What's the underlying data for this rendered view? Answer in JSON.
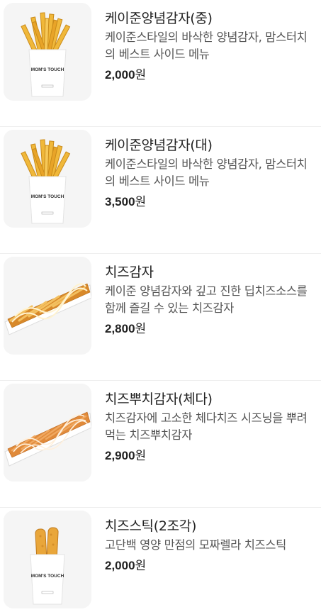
{
  "menu": {
    "items": [
      {
        "name": "케이준양념감자(중)",
        "desc": "케이준스타일의 바삭한 양념감자, 맘스터치의 베스트 사이드 메뉴",
        "price": "2,000",
        "unit": "원",
        "image": "fries-bag-medium",
        "bag_text": "MOM'S TOUCH"
      },
      {
        "name": "케이준양념감자(대)",
        "desc": "케이준스타일의 바삭한 양념감자, 맘스터치의 베스트 사이드 메뉴",
        "price": "3,500",
        "unit": "원",
        "image": "fries-bag-large",
        "bag_text": "MOM'S TOUCH"
      },
      {
        "name": "치즈감자",
        "desc": "케이준 양념감자와 깊고 진한 딥치즈소스를 함께 즐길 수 있는 치즈감자",
        "price": "2,800",
        "unit": "원",
        "image": "cheese-fries-tray"
      },
      {
        "name": "치즈뿌치감자(체다)",
        "desc": "치즈감자에 고소한 체다치즈 시즈닝을 뿌려 먹는 치즈뿌치감자",
        "price": "2,900",
        "unit": "원",
        "image": "cheddar-fries-tray"
      },
      {
        "name": "치즈스틱(2조각)",
        "desc": "고단백 영양 만점의 모짜렐라 치즈스틱",
        "price": "2,000",
        "unit": "원",
        "image": "cheese-stick-bag",
        "bag_text": "MOM'S TOUCH"
      }
    ]
  }
}
